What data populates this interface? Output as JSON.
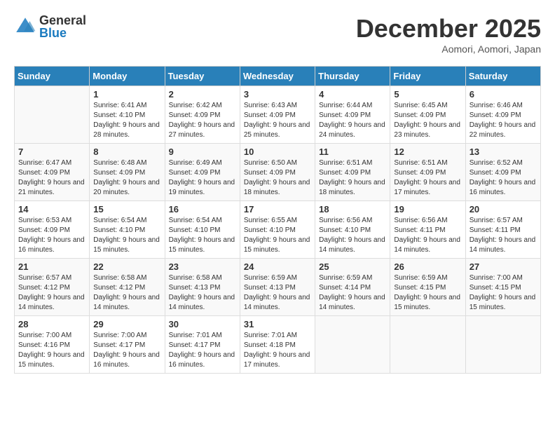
{
  "logo": {
    "general": "General",
    "blue": "Blue"
  },
  "header": {
    "month": "December 2025",
    "location": "Aomori, Aomori, Japan"
  },
  "weekdays": [
    "Sunday",
    "Monday",
    "Tuesday",
    "Wednesday",
    "Thursday",
    "Friday",
    "Saturday"
  ],
  "weeks": [
    [
      {
        "day": "",
        "sunrise": "",
        "sunset": "",
        "daylight": ""
      },
      {
        "day": "1",
        "sunrise": "Sunrise: 6:41 AM",
        "sunset": "Sunset: 4:10 PM",
        "daylight": "Daylight: 9 hours and 28 minutes."
      },
      {
        "day": "2",
        "sunrise": "Sunrise: 6:42 AM",
        "sunset": "Sunset: 4:09 PM",
        "daylight": "Daylight: 9 hours and 27 minutes."
      },
      {
        "day": "3",
        "sunrise": "Sunrise: 6:43 AM",
        "sunset": "Sunset: 4:09 PM",
        "daylight": "Daylight: 9 hours and 25 minutes."
      },
      {
        "day": "4",
        "sunrise": "Sunrise: 6:44 AM",
        "sunset": "Sunset: 4:09 PM",
        "daylight": "Daylight: 9 hours and 24 minutes."
      },
      {
        "day": "5",
        "sunrise": "Sunrise: 6:45 AM",
        "sunset": "Sunset: 4:09 PM",
        "daylight": "Daylight: 9 hours and 23 minutes."
      },
      {
        "day": "6",
        "sunrise": "Sunrise: 6:46 AM",
        "sunset": "Sunset: 4:09 PM",
        "daylight": "Daylight: 9 hours and 22 minutes."
      }
    ],
    [
      {
        "day": "7",
        "sunrise": "Sunrise: 6:47 AM",
        "sunset": "Sunset: 4:09 PM",
        "daylight": "Daylight: 9 hours and 21 minutes."
      },
      {
        "day": "8",
        "sunrise": "Sunrise: 6:48 AM",
        "sunset": "Sunset: 4:09 PM",
        "daylight": "Daylight: 9 hours and 20 minutes."
      },
      {
        "day": "9",
        "sunrise": "Sunrise: 6:49 AM",
        "sunset": "Sunset: 4:09 PM",
        "daylight": "Daylight: 9 hours and 19 minutes."
      },
      {
        "day": "10",
        "sunrise": "Sunrise: 6:50 AM",
        "sunset": "Sunset: 4:09 PM",
        "daylight": "Daylight: 9 hours and 18 minutes."
      },
      {
        "day": "11",
        "sunrise": "Sunrise: 6:51 AM",
        "sunset": "Sunset: 4:09 PM",
        "daylight": "Daylight: 9 hours and 18 minutes."
      },
      {
        "day": "12",
        "sunrise": "Sunrise: 6:51 AM",
        "sunset": "Sunset: 4:09 PM",
        "daylight": "Daylight: 9 hours and 17 minutes."
      },
      {
        "day": "13",
        "sunrise": "Sunrise: 6:52 AM",
        "sunset": "Sunset: 4:09 PM",
        "daylight": "Daylight: 9 hours and 16 minutes."
      }
    ],
    [
      {
        "day": "14",
        "sunrise": "Sunrise: 6:53 AM",
        "sunset": "Sunset: 4:09 PM",
        "daylight": "Daylight: 9 hours and 16 minutes."
      },
      {
        "day": "15",
        "sunrise": "Sunrise: 6:54 AM",
        "sunset": "Sunset: 4:10 PM",
        "daylight": "Daylight: 9 hours and 15 minutes."
      },
      {
        "day": "16",
        "sunrise": "Sunrise: 6:54 AM",
        "sunset": "Sunset: 4:10 PM",
        "daylight": "Daylight: 9 hours and 15 minutes."
      },
      {
        "day": "17",
        "sunrise": "Sunrise: 6:55 AM",
        "sunset": "Sunset: 4:10 PM",
        "daylight": "Daylight: 9 hours and 15 minutes."
      },
      {
        "day": "18",
        "sunrise": "Sunrise: 6:56 AM",
        "sunset": "Sunset: 4:10 PM",
        "daylight": "Daylight: 9 hours and 14 minutes."
      },
      {
        "day": "19",
        "sunrise": "Sunrise: 6:56 AM",
        "sunset": "Sunset: 4:11 PM",
        "daylight": "Daylight: 9 hours and 14 minutes."
      },
      {
        "day": "20",
        "sunrise": "Sunrise: 6:57 AM",
        "sunset": "Sunset: 4:11 PM",
        "daylight": "Daylight: 9 hours and 14 minutes."
      }
    ],
    [
      {
        "day": "21",
        "sunrise": "Sunrise: 6:57 AM",
        "sunset": "Sunset: 4:12 PM",
        "daylight": "Daylight: 9 hours and 14 minutes."
      },
      {
        "day": "22",
        "sunrise": "Sunrise: 6:58 AM",
        "sunset": "Sunset: 4:12 PM",
        "daylight": "Daylight: 9 hours and 14 minutes."
      },
      {
        "day": "23",
        "sunrise": "Sunrise: 6:58 AM",
        "sunset": "Sunset: 4:13 PM",
        "daylight": "Daylight: 9 hours and 14 minutes."
      },
      {
        "day": "24",
        "sunrise": "Sunrise: 6:59 AM",
        "sunset": "Sunset: 4:13 PM",
        "daylight": "Daylight: 9 hours and 14 minutes."
      },
      {
        "day": "25",
        "sunrise": "Sunrise: 6:59 AM",
        "sunset": "Sunset: 4:14 PM",
        "daylight": "Daylight: 9 hours and 14 minutes."
      },
      {
        "day": "26",
        "sunrise": "Sunrise: 6:59 AM",
        "sunset": "Sunset: 4:15 PM",
        "daylight": "Daylight: 9 hours and 15 minutes."
      },
      {
        "day": "27",
        "sunrise": "Sunrise: 7:00 AM",
        "sunset": "Sunset: 4:15 PM",
        "daylight": "Daylight: 9 hours and 15 minutes."
      }
    ],
    [
      {
        "day": "28",
        "sunrise": "Sunrise: 7:00 AM",
        "sunset": "Sunset: 4:16 PM",
        "daylight": "Daylight: 9 hours and 15 minutes."
      },
      {
        "day": "29",
        "sunrise": "Sunrise: 7:00 AM",
        "sunset": "Sunset: 4:17 PM",
        "daylight": "Daylight: 9 hours and 16 minutes."
      },
      {
        "day": "30",
        "sunrise": "Sunrise: 7:01 AM",
        "sunset": "Sunset: 4:17 PM",
        "daylight": "Daylight: 9 hours and 16 minutes."
      },
      {
        "day": "31",
        "sunrise": "Sunrise: 7:01 AM",
        "sunset": "Sunset: 4:18 PM",
        "daylight": "Daylight: 9 hours and 17 minutes."
      },
      {
        "day": "",
        "sunrise": "",
        "sunset": "",
        "daylight": ""
      },
      {
        "day": "",
        "sunrise": "",
        "sunset": "",
        "daylight": ""
      },
      {
        "day": "",
        "sunrise": "",
        "sunset": "",
        "daylight": ""
      }
    ]
  ]
}
